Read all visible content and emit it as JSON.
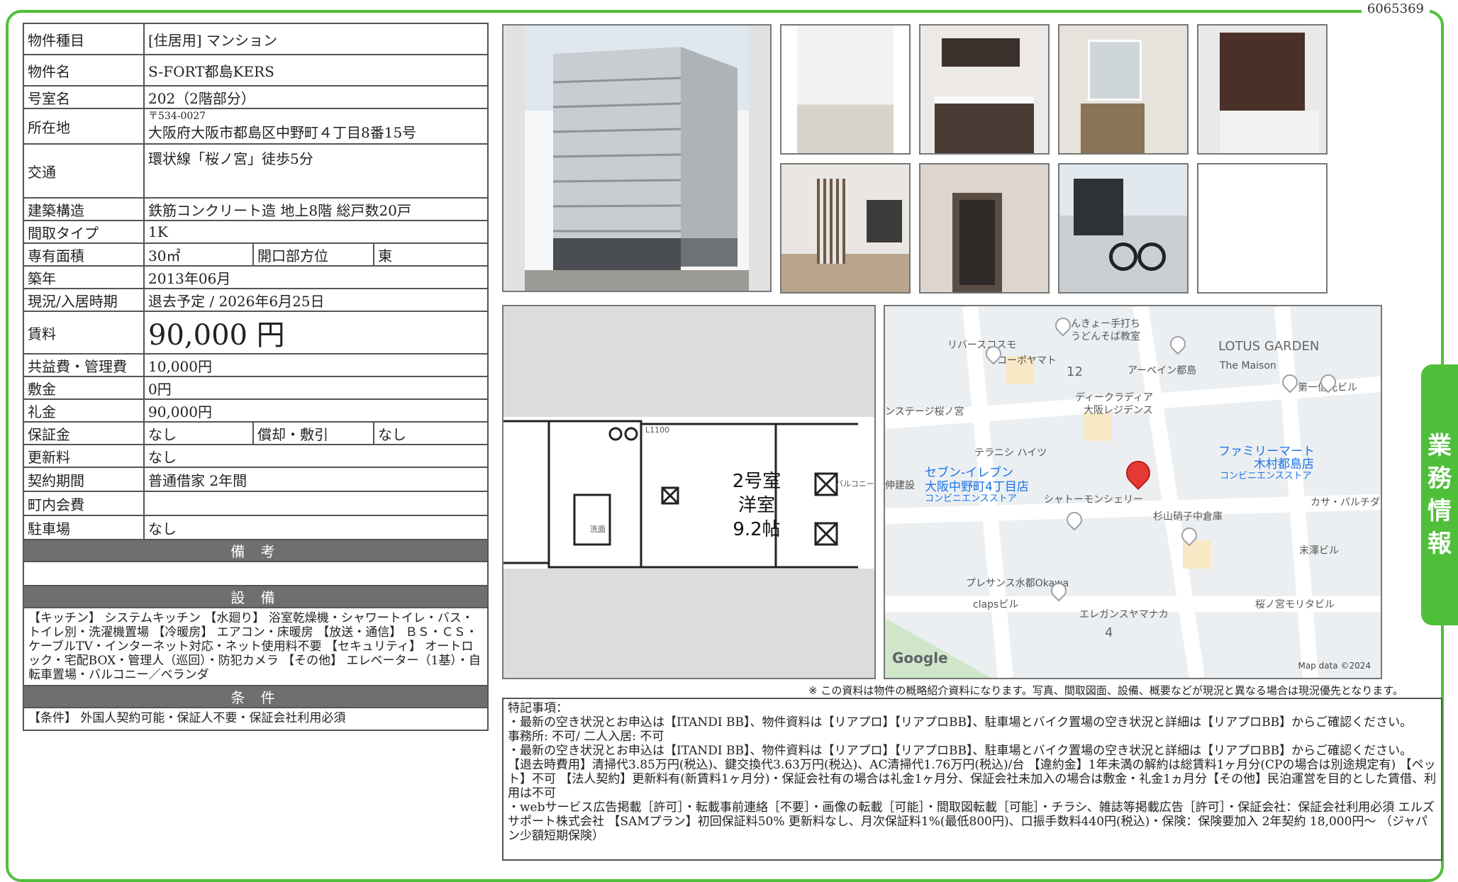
{
  "doc_id": "6065369",
  "side_tab": [
    "業",
    "務",
    "情",
    "報"
  ],
  "rows": {
    "type": {
      "label": "物件種目",
      "value": "[住居用]  マンション"
    },
    "name": {
      "label": "物件名",
      "value": "S-FORT都島KERS"
    },
    "room": {
      "label": "号室名",
      "value": "202（2階部分）"
    },
    "address": {
      "label": "所在地",
      "postal": "〒534-0027",
      "value": "大阪府大阪市都島区中野町４丁目8番15号"
    },
    "access": {
      "label": "交通",
      "value": "環状線「桜ノ宮」徒歩5分"
    },
    "structure": {
      "label": "建築構造",
      "value": "鉄筋コンクリート造  地上8階  総戸数20戸"
    },
    "layout": {
      "label": "間取タイプ",
      "value": "1K"
    },
    "area": {
      "label": "専有面積",
      "value": "30㎡",
      "label2": "開口部方位",
      "value2": "東"
    },
    "built": {
      "label": "築年",
      "value": "2013年06月"
    },
    "status": {
      "label": "現況/入居時期",
      "value": "退去予定  /  2026年6月25日"
    },
    "rent": {
      "label": "賃料",
      "value": "90,000 円"
    },
    "fee": {
      "label": "共益費・管理費",
      "value": "10,000円"
    },
    "deposit": {
      "label": "敷金",
      "value": "0円"
    },
    "key_money": {
      "label": "礼金",
      "value": "90,000円"
    },
    "guarantee": {
      "label": "保証金",
      "value": "なし",
      "label2": "償却・敷引",
      "value2": "なし"
    },
    "renewal": {
      "label": "更新料",
      "value": "なし"
    },
    "contract": {
      "label": "契約期間",
      "value": "普通借家 2年間"
    },
    "town_fee": {
      "label": "町内会費",
      "value": ""
    },
    "parking": {
      "label": "駐車場",
      "value": "なし"
    }
  },
  "sections": {
    "remarks_header": "備 考",
    "equipment_header": "設 備",
    "equipment_text": "【キッチン】 システムキッチン 【水廻り】 浴室乾燥機・シャワートイレ・バス・トイレ別・洗濯機置場 【冷暖房】 エアコン・床暖房 【放送・通信】 ＢＳ・ＣＳ・ケーブルTV・インターネット対応・ネット使用料不要 【セキュリティ】 オートロック・宅配BOX・管理人（巡回）・防犯カメラ 【その他】 エレベーター（1基）・自転車置場・バルコニー／ベランダ",
    "conditions_header": "条 件",
    "conditions_text": "【条件】 外国人契約可能・保証人不要・保証会社利用必須"
  },
  "floorplan": {
    "room_label_1": "2号室",
    "room_label_2": "洋室",
    "room_label_3": "9.2帖",
    "small_1": "L1100",
    "small_2": "洗面",
    "small_3": "バルコニー"
  },
  "map": {
    "labels": [
      "めんきょー手打ち",
      "うどんそば教室",
      "リバースコスモ",
      "コーポヤマト",
      "12",
      "アーベイン都島",
      "LOTUS GARDEN",
      "The Maison",
      "第一信光ビル",
      "ディークラディア",
      "大阪レジデンス",
      "ンステージ桜ノ宮",
      "テラニシ ハイツ",
      "セブン-イレブン",
      "大阪中野町4丁目店",
      "コンビニエンスストア",
      "ファミリーマート",
      "木村都島店",
      "コンビニエンスストア",
      "伸建設",
      "シャトーモンシェリー",
      "杉山硝子中倉庫",
      "カサ・パルチダ",
      "末澤ビル",
      "プレサンス水都Okawa",
      "clapsビル",
      "桜ノ宮モリタビル",
      "エレガンスヤマナカ",
      "4"
    ],
    "google": "Google",
    "attribution": "Map data ©2024"
  },
  "footnote": "※ この資料は物件の概略紹介資料になります。写真、間取図面、設備、概要などが現況と異なる場合は現況優先となります。",
  "remarks": [
    "特記事項：",
    "・最新の空き状況とお申込は【ITANDI BB】、物件資料は【リアプロ】【リアプロBB】、駐車場とバイク置場の空き状況と詳細は【リアプロBB】からご確認ください。",
    "事務所: 不可/ 二人入居: 不可",
    "・最新の空き状況とお申込は【ITANDI BB】、物件資料は【リアプロ】【リアプロBB】、駐車場とバイク置場の空き状況と詳細は【リアプロBB】からご確認ください。 【退去時費用】清掃代3.85万円(税込)、鍵交換代3.63万円(税込)、AC清掃代1.76万円(税込)/台 【違約金】1年未満の解約は総賃料1ヶ月分(CPの場合は別途規定有) 【ペット】不可 【法人契約】更新料有(新賃料1ヶ月分)・保証会社有の場合は礼金1ヶ月分、保証会社未加入の場合は敷金・礼金1ヵ月分【その他】民泊運営を目的とした賃借、利用は不可",
    "・webサービス広告掲載［許可］・転載事前連絡［不要］・画像の転載［可能］・間取図転載［可能］・チラシ、雑誌等掲載広告［許可］・保証会社：保証会社利用必須 エルズサポート株式会社 【SAMプラン】初回保証料50% 更新料なし、月次保証料1%(最低800円)、口振手数料440円(税込)・保険：保険要加入 2年契約 18,000円～ （ジャパン少額短期保険）"
  ]
}
